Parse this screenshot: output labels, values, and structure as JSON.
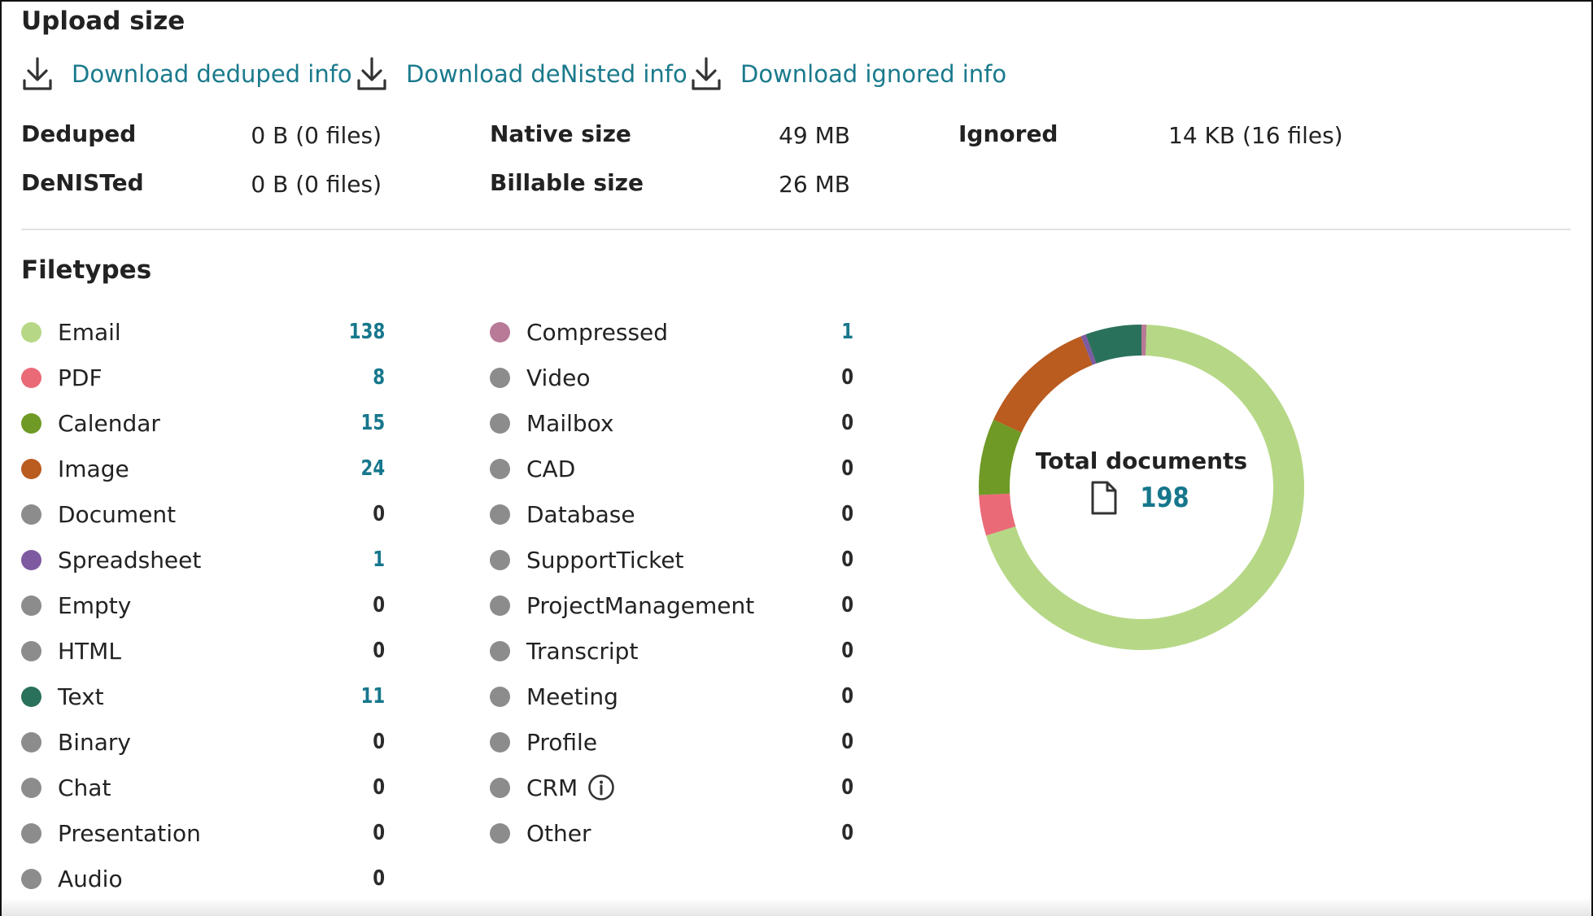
{
  "upload": {
    "title": "Upload size",
    "downloads": [
      {
        "label": "Download deduped info",
        "icon": "download-icon"
      },
      {
        "label": "Download deNisted info",
        "icon": "download-icon"
      },
      {
        "label": "Download ignored info",
        "icon": "download-icon"
      }
    ],
    "stats": {
      "deduped_label": "Deduped",
      "deduped_value": "0 B (0 files)",
      "denisted_label": "DeNISTed",
      "denisted_value": "0 B (0 files)",
      "native_label": "Native size",
      "native_value": "49 MB",
      "billable_label": "Billable size",
      "billable_value": "26 MB",
      "ignored_label": "Ignored",
      "ignored_value": "14 KB (16 files)"
    }
  },
  "filetypes": {
    "title": "Filetypes",
    "left": [
      {
        "name": "Email",
        "count": "138",
        "color": "#b6d886"
      },
      {
        "name": "PDF",
        "count": "8",
        "color": "#ea6a78"
      },
      {
        "name": "Calendar",
        "count": "15",
        "color": "#6f9a26"
      },
      {
        "name": "Image",
        "count": "24",
        "color": "#ba5b1f"
      },
      {
        "name": "Document",
        "count": "0",
        "color": "#8c8c8c"
      },
      {
        "name": "Spreadsheet",
        "count": "1",
        "color": "#7e5aa0"
      },
      {
        "name": "Empty",
        "count": "0",
        "color": "#8c8c8c"
      },
      {
        "name": "HTML",
        "count": "0",
        "color": "#8c8c8c"
      },
      {
        "name": "Text",
        "count": "11",
        "color": "#2a715b"
      },
      {
        "name": "Binary",
        "count": "0",
        "color": "#8c8c8c"
      },
      {
        "name": "Chat",
        "count": "0",
        "color": "#8c8c8c"
      },
      {
        "name": "Presentation",
        "count": "0",
        "color": "#8c8c8c"
      },
      {
        "name": "Audio",
        "count": "0",
        "color": "#8c8c8c"
      }
    ],
    "right": [
      {
        "name": "Compressed",
        "count": "1",
        "color": "#b87a96"
      },
      {
        "name": "Video",
        "count": "0",
        "color": "#8c8c8c"
      },
      {
        "name": "Mailbox",
        "count": "0",
        "color": "#8c8c8c"
      },
      {
        "name": "CAD",
        "count": "0",
        "color": "#8c8c8c"
      },
      {
        "name": "Database",
        "count": "0",
        "color": "#8c8c8c"
      },
      {
        "name": "SupportTicket",
        "count": "0",
        "color": "#8c8c8c"
      },
      {
        "name": "ProjectManagement",
        "count": "0",
        "color": "#8c8c8c"
      },
      {
        "name": "Transcript",
        "count": "0",
        "color": "#8c8c8c"
      },
      {
        "name": "Meeting",
        "count": "0",
        "color": "#8c8c8c"
      },
      {
        "name": "Profile",
        "count": "0",
        "color": "#8c8c8c"
      },
      {
        "name": "CRM",
        "count": "0",
        "color": "#8c8c8c",
        "icon": "info-icon"
      },
      {
        "name": "Other",
        "count": "0",
        "color": "#8c8c8c"
      }
    ]
  },
  "total": {
    "label": "Total documents",
    "value": "198",
    "icon": "document-icon"
  },
  "colors": {
    "accent": "#16778c",
    "link": "#1a7a8c"
  }
}
